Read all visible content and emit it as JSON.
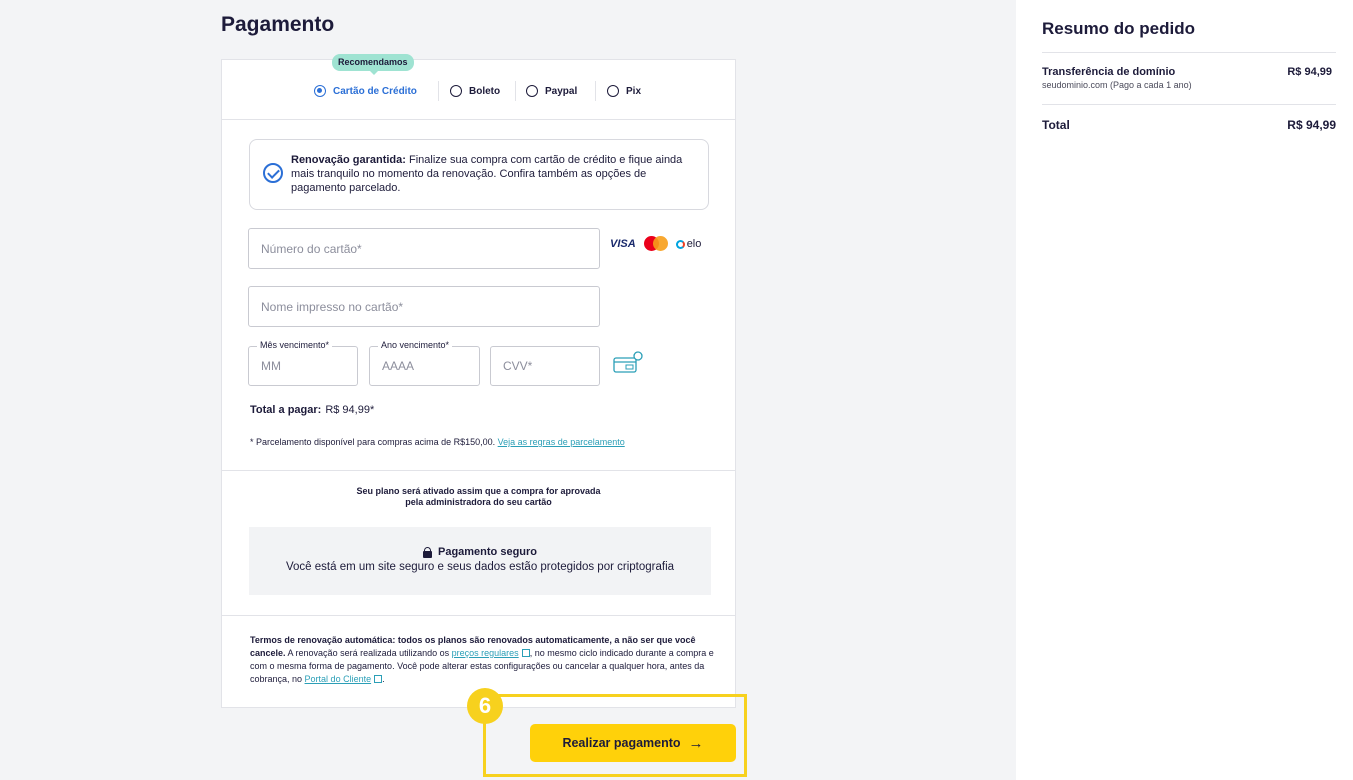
{
  "payment": {
    "title": "Pagamento",
    "recommended_badge": "Recomendamos",
    "methods": [
      {
        "label": "Cartão de Crédito",
        "selected": true
      },
      {
        "label": "Boleto",
        "selected": false
      },
      {
        "label": "Paypal",
        "selected": false
      },
      {
        "label": "Pix",
        "selected": false
      }
    ],
    "notice": {
      "bold": "Renovação garantida:",
      "text": " Finalize sua compra com cartão de crédito e fique ainda mais tranquilo no momento da renovação. Confira também as opções de pagamento parcelado."
    },
    "card_number": {
      "placeholder": "Número do cartão*",
      "value": ""
    },
    "card_name": {
      "placeholder": "Nome impresso no cartão*",
      "value": ""
    },
    "month": {
      "label": "Mês vencimento*",
      "placeholder": "MM",
      "value": ""
    },
    "year": {
      "label": "Ano vencimento*",
      "placeholder": "AAAA",
      "value": ""
    },
    "cvv": {
      "placeholder": "CVV*",
      "value": ""
    },
    "brands": {
      "visa": "VISA",
      "elo": "elo"
    },
    "total_label": "Total a pagar:",
    "total_value": "R$ 94,99*",
    "installment_note": "* Parcelamento disponível para compras acima de R$150,00.",
    "installment_link": "Veja as regras de parcelamento",
    "plan_line1": "Seu plano será ativado assim que a compra for aprovada",
    "plan_line2": "pela administradora do seu cartão",
    "secure_title": "Pagamento seguro",
    "secure_text": "Você está em um site seguro e seus dados estão protegidos por criptografia",
    "terms": {
      "bold": "Termos de renovação automática: todos os planos são renovados automaticamente, a não ser que você cancele.",
      "text1": " A renovação será realizada utilizando os ",
      "link1": "preços regulares",
      "text2": ", no mesmo ciclo indicado durante a compra e com o mesma forma de pagamento. Você pode alterar estas configurações ou cancelar a qualquer hora, antes da cobrança, no ",
      "link2": "Portal do Cliente",
      "text3": "."
    },
    "step_number": "6",
    "pay_button": "Realizar pagamento",
    "pay_arrow": "→"
  },
  "summary": {
    "title": "Resumo do pedido",
    "item_name": "Transferência de domínio",
    "item_sub": "seudominio.com (Pago a cada 1 ano)",
    "item_price": "R$ 94,99",
    "total_label": "Total",
    "total_value": "R$ 94,99"
  },
  "colors": {
    "accent": "#2b6fd6",
    "button": "#ffd10a",
    "highlight": "#f7d11e",
    "badge": "#9fe3d2"
  }
}
